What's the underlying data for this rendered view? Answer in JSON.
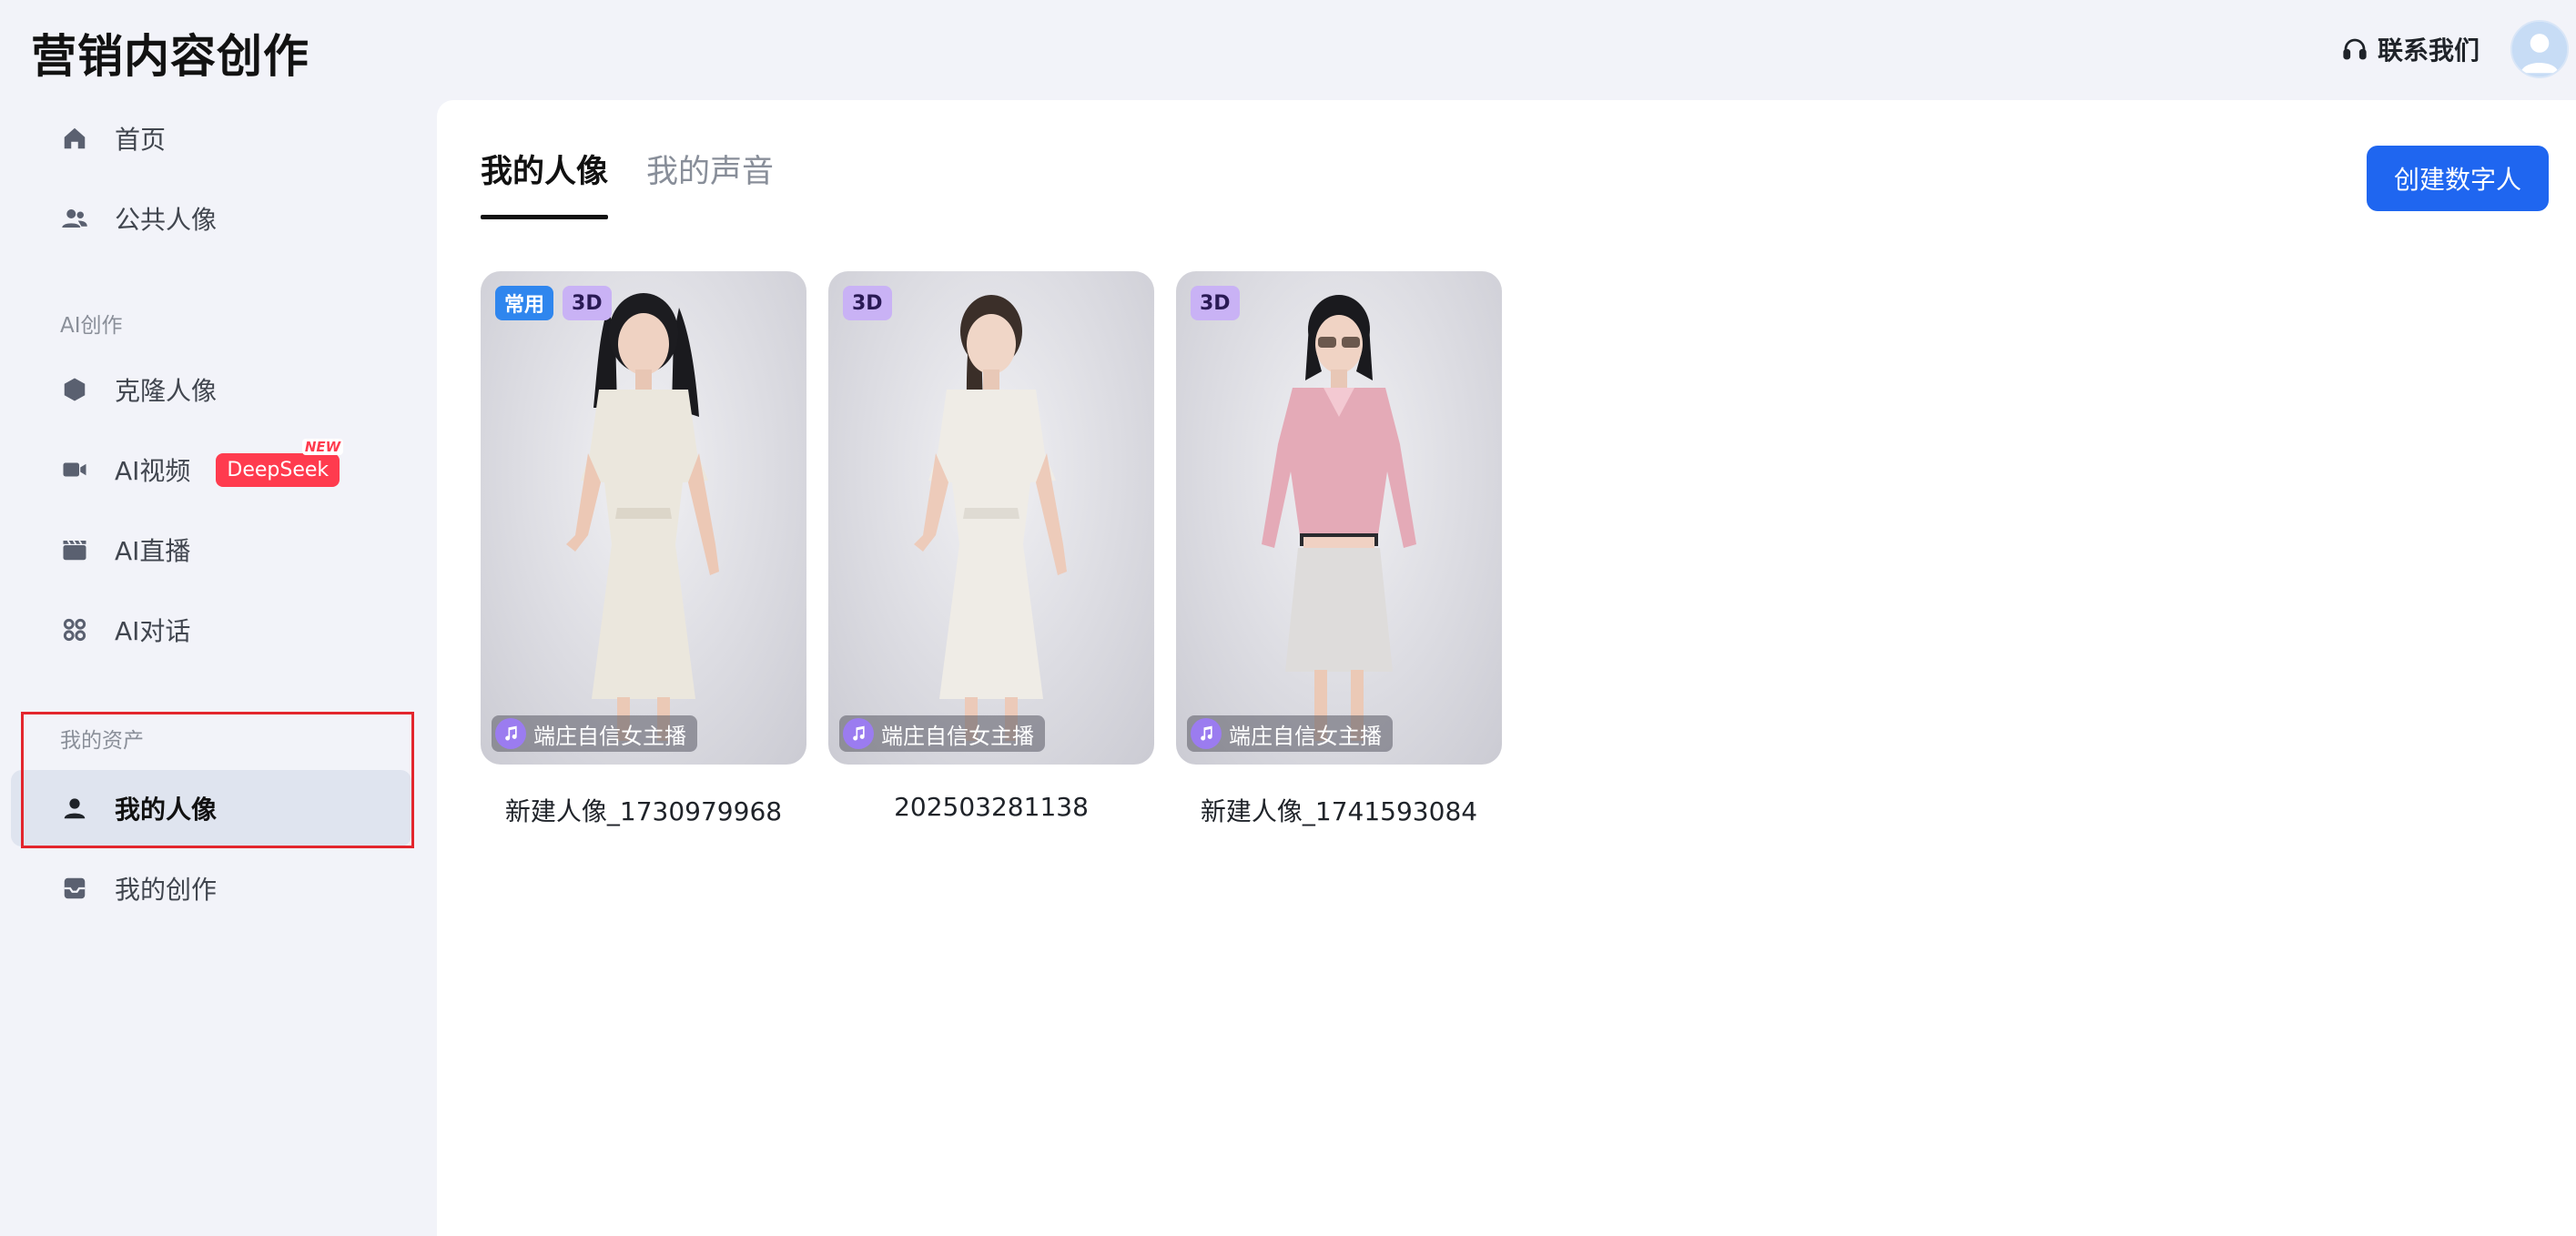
{
  "header": {
    "brand": "营销内容创作",
    "contact": "联系我们",
    "contact_icon": "headset-icon",
    "avatar_icon": "user-avatar-icon"
  },
  "sidebar": {
    "items_top": [
      {
        "label": "首页",
        "icon": "home-icon"
      },
      {
        "label": "公共人像",
        "icon": "users-icon"
      }
    ],
    "section_ai": "AI创作",
    "items_ai": [
      {
        "label": "克隆人像",
        "icon": "hexagon-icon"
      },
      {
        "label": "AI视频",
        "icon": "video-camera-icon",
        "badge": "DeepSeek",
        "badge_new": "NEW"
      },
      {
        "label": "AI直播",
        "icon": "clapperboard-icon"
      },
      {
        "label": "AI对话",
        "icon": "chat-nodes-icon"
      }
    ],
    "section_assets": "我的资产",
    "items_assets": [
      {
        "label": "我的人像",
        "icon": "person-icon",
        "active": true
      },
      {
        "label": "我的创作",
        "icon": "inbox-icon"
      }
    ]
  },
  "main": {
    "tabs": [
      {
        "label": "我的人像",
        "active": true
      },
      {
        "label": "我的声音",
        "active": false
      }
    ],
    "create_button": "创建数字人",
    "cards": [
      {
        "name": "新建人像_1730979968",
        "tags": [
          "常用",
          "3D"
        ],
        "voice": "端庄自信女主播",
        "outfit": "white-dress"
      },
      {
        "name": "202503281138",
        "tags": [
          "3D"
        ],
        "voice": "端庄自信女主播",
        "outfit": "white-dress-ponytail"
      },
      {
        "name": "新建人像_1741593084",
        "tags": [
          "3D"
        ],
        "voice": "端庄自信女主播",
        "outfit": "pink-jacket-skirt"
      }
    ]
  },
  "colors": {
    "accent": "#1f66f0",
    "deepseek_badge": "#ff3b4e",
    "highlight_box": "#e3262d",
    "tag_common": "#2f86ee",
    "tag_3d": "#c9b2f5"
  }
}
